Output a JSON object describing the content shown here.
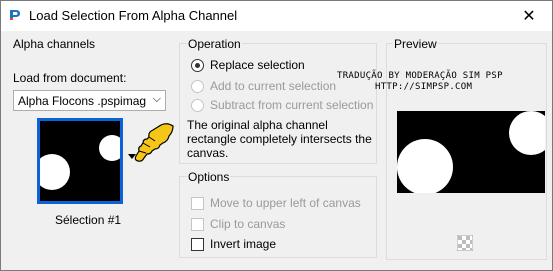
{
  "window": {
    "title": "Load Selection From Alpha Channel",
    "close_icon": "close-icon"
  },
  "alpha_channels": {
    "group_label": "Alpha channels",
    "load_from_label": "Load from document:",
    "document_value": "Alpha Flocons .pspimage",
    "selection_label": "Sélection #1"
  },
  "operation": {
    "group_label": "Operation",
    "options": [
      {
        "label": "Replace selection",
        "checked": true,
        "enabled": true
      },
      {
        "label": "Add to current selection",
        "checked": false,
        "enabled": false
      },
      {
        "label": "Subtract from current selection",
        "checked": false,
        "enabled": false
      }
    ],
    "description": "The original alpha channel rectangle completely intersects the canvas."
  },
  "options": {
    "group_label": "Options",
    "items": [
      {
        "label": "Move to upper left of canvas",
        "checked": false,
        "enabled": false
      },
      {
        "label": "Clip to canvas",
        "checked": false,
        "enabled": false
      },
      {
        "label": "Invert image",
        "checked": false,
        "enabled": true
      }
    ]
  },
  "watermark": {
    "line1": "TRADUÇÃO BY MODERAÇÃO SIM PSP",
    "line2": "HTTP://SIMPSP.COM"
  },
  "preview": {
    "group_label": "Preview",
    "transparency_icon": "checkerboard-icon"
  },
  "colors": {
    "accent": "#0a64d8",
    "pointer_yellow": "#f5c518"
  }
}
